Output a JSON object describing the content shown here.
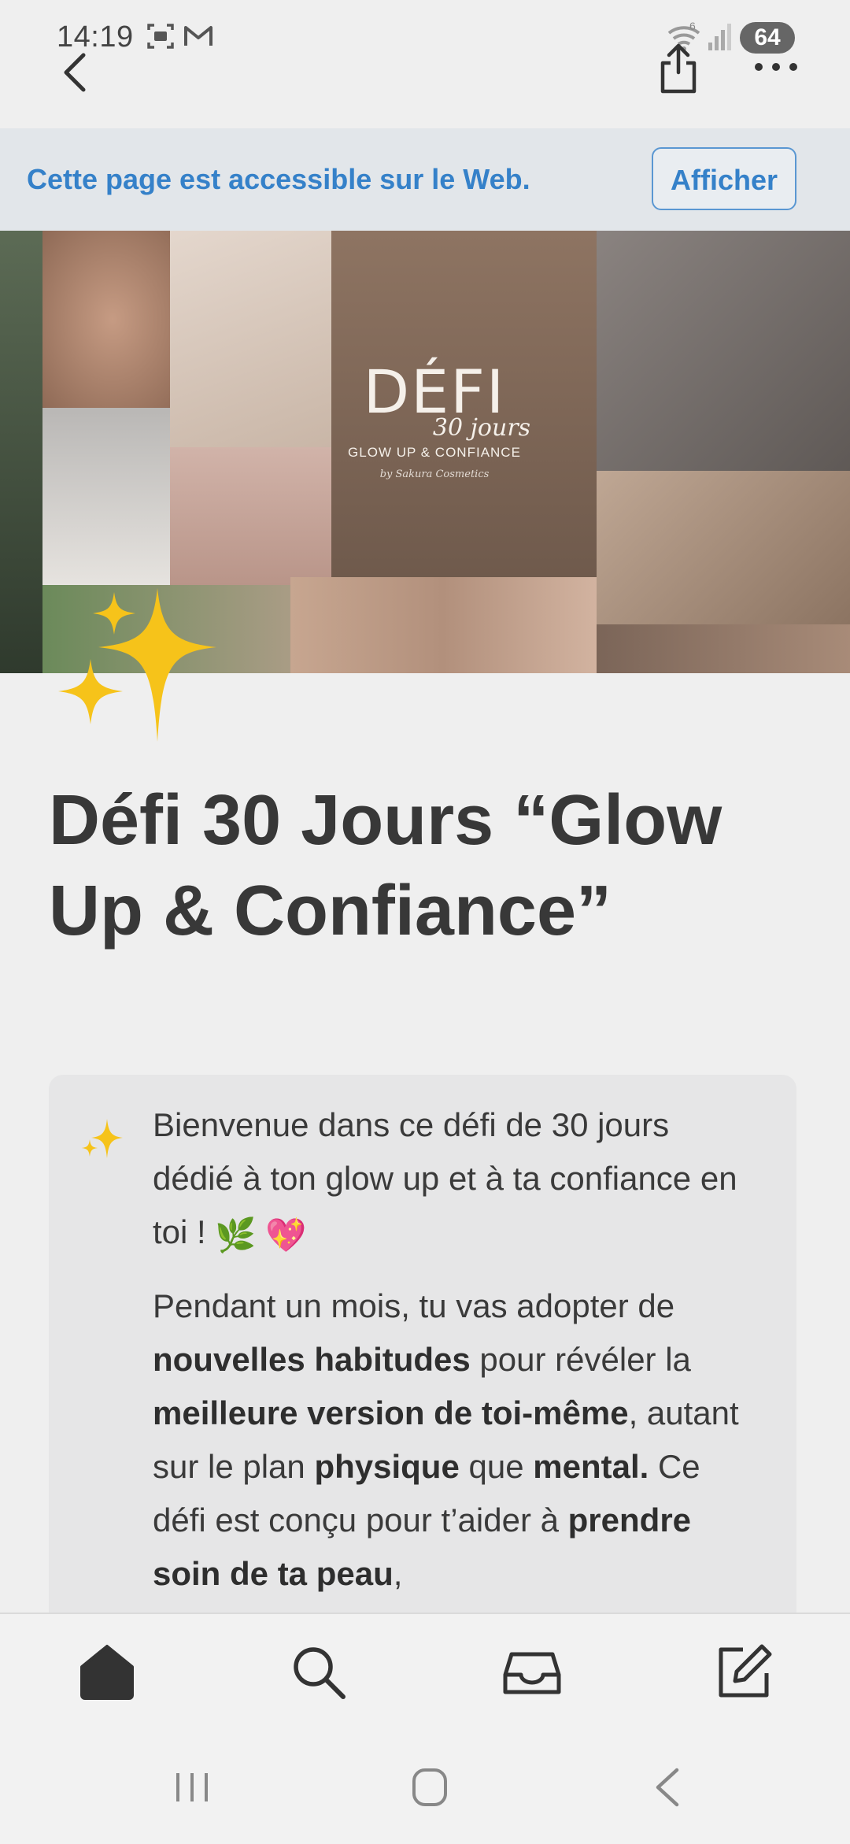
{
  "status_bar": {
    "time": "14:19",
    "battery": "64",
    "icons": [
      "screenshot-icon",
      "gmail-icon",
      "wifi-icon",
      "signal-icon"
    ]
  },
  "top_nav": {
    "back_icon": "chevron-left-icon",
    "share_icon": "share-icon",
    "more_icon": "more-dots-icon"
  },
  "web_banner": {
    "text": "Cette page est accessible sur le Web.",
    "button": "Afficher"
  },
  "cover": {
    "logo_main": "DÉFI",
    "logo_script": "30 jours",
    "logo_sub": "GLOW UP   &   CONFIANCE",
    "logo_credit": "by Sakura Cosmetics"
  },
  "page": {
    "icon": "sparkles-icon",
    "title": "Défi 30 Jours “Glow Up & Confiance”"
  },
  "callout": {
    "icon": "sparkles-icon",
    "p1_text": "Bienvenue dans ce défi de 30 jours dédié à ton glow up et à ta confiance en toi !",
    "p1_emoji1": "🌿",
    "p1_emoji2": "💖",
    "p2": {
      "t1": "Pendant un mois, tu vas adopter de ",
      "b1": "nouvelles habitudes",
      "t2": " pour révéler la ",
      "b2": "meilleure version de toi-même",
      "t3": ", autant sur le plan ",
      "b3": "physique",
      "t4": " que ",
      "b4": "mental.",
      "t5": " Ce défi est conçu pour t’aider à ",
      "b5": "prendre soin de ta peau",
      "t6": ","
    }
  },
  "bottom_tabs": [
    "home-icon",
    "search-icon",
    "inbox-icon",
    "compose-icon"
  ],
  "system_nav": [
    "recents-icon",
    "home-circle-icon",
    "back-icon"
  ],
  "colors": {
    "accent_blue": "#3581c9",
    "banner_bg": "#e2e6ea",
    "page_bg": "#efefef",
    "callout_bg": "#e6e6e7",
    "sparkle_yellow": "#f6c31a"
  }
}
